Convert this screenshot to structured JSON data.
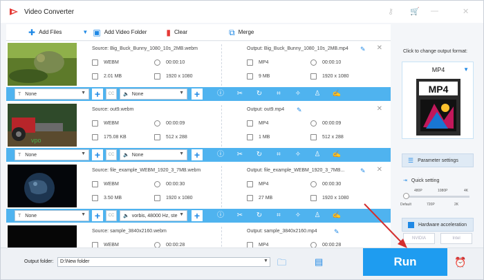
{
  "window": {
    "title": "Video Converter"
  },
  "toolbar": {
    "add_files": "Add Files",
    "add_folder": "Add Video Folder",
    "clear": "Clear",
    "merge": "Merge"
  },
  "videos": [
    {
      "source": "Source: Big_Buck_Bunny_1080_10s_2MB.webm",
      "src_format": "WEBM",
      "src_duration": "00:00:10",
      "src_size": "2.01 MB",
      "src_res": "1920 x 1080",
      "output": "Output: Big_Buck_Bunny_1080_10s_2MB.mp4",
      "out_format": "MP4",
      "out_duration": "00:00:10",
      "out_size": "9 MB",
      "out_res": "1920 x 1080",
      "subtitle": "None",
      "audio": "None"
    },
    {
      "source": "Source: out9.webm",
      "src_format": "WEBM",
      "src_duration": "00:00:09",
      "src_size": "175.08 KB",
      "src_res": "512 x 288",
      "output": "Output: out9.mp4",
      "out_format": "MP4",
      "out_duration": "00:00:09",
      "out_size": "1 MB",
      "out_res": "512 x 288",
      "subtitle": "None",
      "audio": "None"
    },
    {
      "source": "Source: file_example_WEBM_1920_3_7MB.webm",
      "src_format": "WEBM",
      "src_duration": "00:00:30",
      "src_size": "3.50 MB",
      "src_res": "1920 x 1080",
      "output": "Output: file_example_WEBM_1920_3_7MB...",
      "out_format": "MP4",
      "out_duration": "00:00:30",
      "out_size": "27 MB",
      "out_res": "1920 x 1080",
      "subtitle": "None",
      "audio": "vorbis, 48000 Hz, ste"
    },
    {
      "source": "Source: sample_3840x2160.webm",
      "src_format": "WEBM",
      "src_duration": "00:00:28",
      "src_size": "",
      "src_res": "",
      "output": "Output: sample_3840x2160.mp4",
      "out_format": "MP4",
      "out_duration": "00:00:28",
      "out_size": "",
      "out_res": "",
      "subtitle": "",
      "audio": ""
    }
  ],
  "right_panel": {
    "change_label": "Click to change output format:",
    "format": "MP4",
    "format_icon_text": "MP4",
    "parameter_settings": "Parameter settings",
    "quick_setting": "Quick setting",
    "ticks_top": [
      "480P",
      "1080P",
      "4K"
    ],
    "ticks_bottom": [
      "Default",
      "720P",
      "2K"
    ],
    "hw_accel": "Hardware acceleration",
    "gpu_nvidia": "NVIDIA",
    "gpu_intel": "Intel"
  },
  "bottom": {
    "output_folder_label": "Output folder:",
    "output_folder_value": "D:\\New folder",
    "run": "Run"
  },
  "colors": {
    "accent": "#1e9cf0",
    "bar": "#4fb3ef",
    "arrow": "#d32f2f"
  }
}
